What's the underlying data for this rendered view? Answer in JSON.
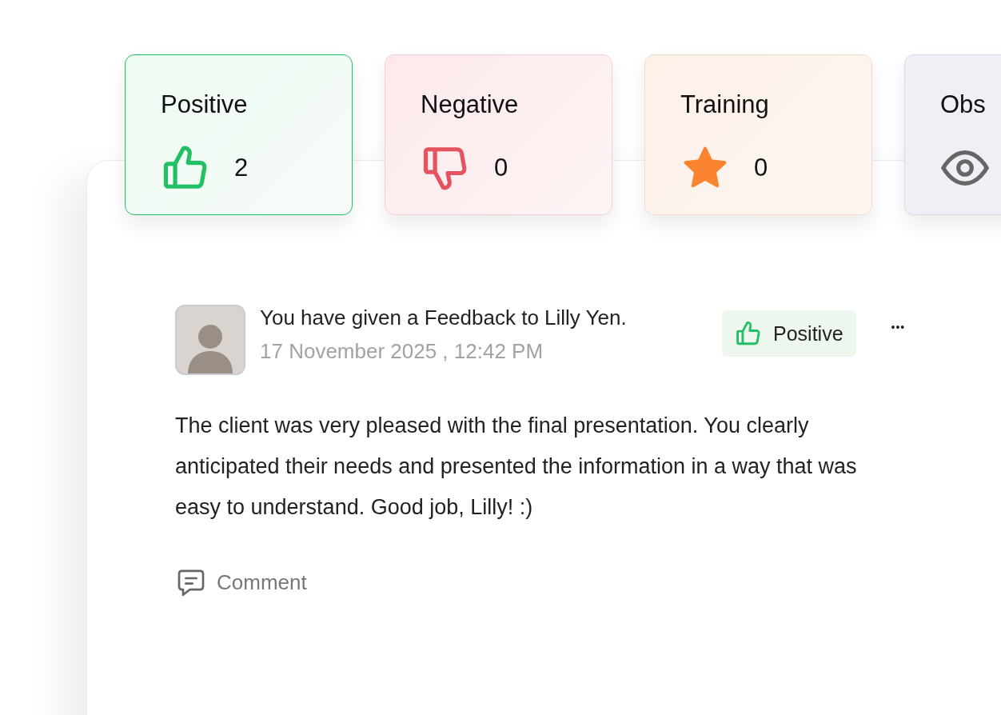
{
  "categories": [
    {
      "kind": "positive",
      "label": "Positive",
      "count": "2",
      "selected": true
    },
    {
      "kind": "negative",
      "label": "Negative",
      "count": "0",
      "selected": false
    },
    {
      "kind": "training",
      "label": "Training",
      "count": "0",
      "selected": false
    },
    {
      "kind": "observation",
      "label": "Obs",
      "selected": false
    }
  ],
  "feedback": {
    "headline": "You have given a Feedback to Lilly Yen.",
    "timestamp": "17 November 2025 , 12:42 PM",
    "tag": {
      "kind": "positive",
      "label": "Positive"
    },
    "more": "•••",
    "body": "The client was very pleased with the final presentation. You clearly anticipated their needs and presented the information in a way that was easy to understand. Good job, Lilly! :)",
    "comment_label": "Comment"
  }
}
